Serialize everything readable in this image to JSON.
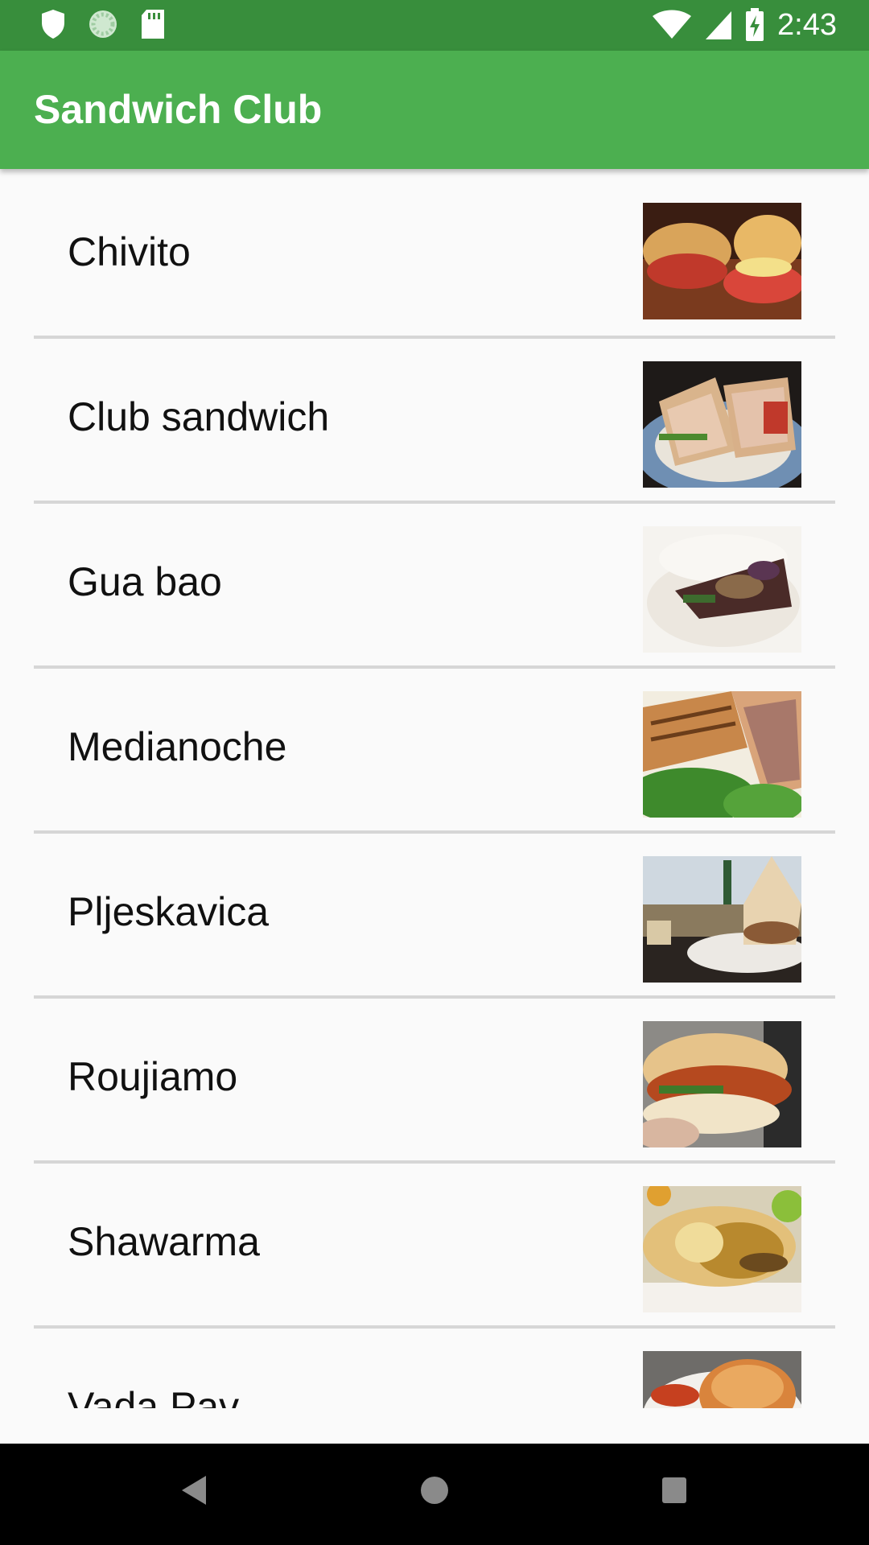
{
  "status_bar": {
    "time": "2:43",
    "left_icons": [
      "shield-icon",
      "sync-icon",
      "sd-card-icon"
    ],
    "right_icons": [
      "wifi-icon",
      "signal-icon",
      "battery-charging-icon"
    ]
  },
  "app_bar": {
    "title": "Sandwich Club",
    "color": "#4caf50",
    "status_color": "#388e3c"
  },
  "sandwiches": [
    {
      "name": "Chivito"
    },
    {
      "name": "Club sandwich"
    },
    {
      "name": "Gua bao"
    },
    {
      "name": "Medianoche"
    },
    {
      "name": "Pljeskavica"
    },
    {
      "name": "Roujiamo"
    },
    {
      "name": "Shawarma"
    },
    {
      "name": "Vada Pav"
    }
  ],
  "nav_bar": {
    "icons": [
      "back-icon",
      "home-icon",
      "recents-icon"
    ]
  }
}
